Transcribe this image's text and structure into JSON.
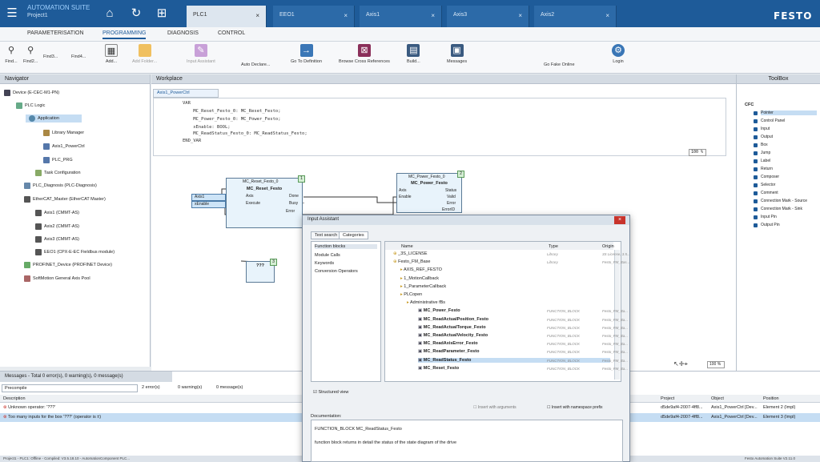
{
  "app": {
    "title": "AUTOMATION SUITE",
    "project": "Project1",
    "logo": "FESTO"
  },
  "tabs": [
    {
      "label": "PLC1",
      "active": true
    },
    {
      "label": "EEO1"
    },
    {
      "label": "Axis1"
    },
    {
      "label": "Axis3"
    },
    {
      "label": "Axis2"
    }
  ],
  "menu": [
    "PARAMETERISATION",
    "PROGRAMMING",
    "DIAGNOSIS",
    "CONTROL"
  ],
  "ribbon": [
    "Find...",
    "Find2...",
    "Find3...",
    "Find4...",
    "Add...",
    "Add Folder...",
    "Input Assistant",
    "Auto Declare...",
    "Go To Definition",
    "Browse Cross References",
    "Build...",
    "Messages",
    "Go Fake Online",
    "Login"
  ],
  "navigator": {
    "title": "Navigator",
    "items": [
      "Device (E-CEC-M1-PN)",
      "PLC Logic",
      "Application",
      "Library Manager",
      "Axis1_PowerCtrl",
      "PLC_PRG",
      "Task Configuration",
      "PLC_Diagnosis (PLC-Diagnosis)",
      "EtherCAT_Master (EtherCAT Master)",
      "Axis1 (CMMT-AS)",
      "Axis2 (CMMT-AS)",
      "Axis3 (CMMT-AS)",
      "EEO1 (CPX-E-EC Fieldbus module)",
      "PROFINET_Device (PROFINET Device)",
      "SoftMotion General Axis Pool"
    ]
  },
  "workplace": {
    "title": "Workplace",
    "editor_tab": "Axis1_PowerCtrl",
    "decl": [
      "VAR",
      "    MC_Reset_Festo_0: MC_Reset_Festo;",
      "    MC_Power_Festo_0: MC_Power_Festo;",
      "    xEnable: BOOL;",
      "    MC_ReadStatus_Festo_0: MC_ReadStatus_Festo;",
      "END_VAR"
    ],
    "zoom_decl": "100 %",
    "zoom_cfc": "100 %",
    "blocks": {
      "reset": {
        "instance": "MC_Reset_Festo_0",
        "type": "MC_Reset_Festo",
        "inputs": [
          "Axis",
          "Execute"
        ],
        "outputs": [
          "Done",
          "Busy",
          "Error"
        ],
        "tag": "1"
      },
      "power": {
        "instance": "MC_Power_Festo_0",
        "type": "MC_Power_Festo",
        "inputs": [
          "Axis",
          "Enable"
        ],
        "outputs": [
          "Status",
          "Valid",
          "Error",
          "ErrorID"
        ],
        "tag": "2"
      },
      "unknown": {
        "label": "???",
        "tag": "3"
      }
    },
    "vars": [
      "Axis1",
      "xEnable"
    ]
  },
  "toolbox": {
    "title": "ToolBox",
    "group": "CFC",
    "items": [
      "Pointer",
      "Control Panel",
      "Input",
      "Output",
      "Box",
      "Jump",
      "Label",
      "Return",
      "Composer",
      "Selector",
      "Comment",
      "Connection Mark - Source",
      "Connection Mark - Sink",
      "Input Pin",
      "Output Pin"
    ]
  },
  "messages": {
    "title": "Messages - Total 0 error(s), 0 warning(s), 0 message(s)",
    "filter": "Precompile",
    "counters": [
      "2 error(s)",
      "0 warning(s)",
      "0 message(s)"
    ],
    "columns": [
      "Description",
      "Project",
      "Object",
      "Position"
    ],
    "rows": [
      {
        "desc": "Unknown operator: '???'",
        "project": "d5de9af4-2007-4ff8...",
        "object": "Axis1_PowerCtrl [Dev...",
        "pos": "Element 2 (Impl)"
      },
      {
        "desc": "Too many inputs for the box '???' (operator is ±)",
        "project": "d5de9af4-2007-4ff8...",
        "object": "Axis1_PowerCtrl [Dev...",
        "pos": "Element 3 (Impl)"
      }
    ],
    "status_left": "Project1 - PLC1: Offline - Compiled: V3.5.18.10 - AutomationComponent PLC...",
    "status_right": "Festo Automation Suite V2.11.0"
  },
  "dialog": {
    "title": "Input Assistant",
    "tabs": [
      "Text search",
      "Categories"
    ],
    "categories": [
      "Function blocks",
      "Module Calls",
      "Keywords",
      "Conversion Operators"
    ],
    "columns": [
      "Name",
      "Type",
      "Origin"
    ],
    "rows": [
      {
        "name": "_3S_LICENSE",
        "type": "Library",
        "origin": "3S License, 3.5...",
        "level": 1,
        "bold": false
      },
      {
        "name": "Festo_FM_Base",
        "type": "Library",
        "origin": "Festo_FM_Bas...",
        "level": 1,
        "bold": false
      },
      {
        "name": "AXIS_REF_FESTO",
        "type": "",
        "origin": "",
        "level": 2,
        "bold": false
      },
      {
        "name": "1_MotionCallback",
        "type": "",
        "origin": "",
        "level": 2,
        "bold": false
      },
      {
        "name": "1_ParameterCallback",
        "type": "",
        "origin": "",
        "level": 2,
        "bold": false
      },
      {
        "name": "PLCopen",
        "type": "",
        "origin": "",
        "level": 2,
        "bold": false
      },
      {
        "name": "Administrative fBs",
        "type": "",
        "origin": "",
        "level": 3,
        "bold": false
      },
      {
        "name": "MC_Power_Festo",
        "type": "FUNCTION_BLOCK",
        "origin": "Festo_FM_Ba...",
        "level": 4,
        "bold": true
      },
      {
        "name": "MC_ReadActualPosition_Festo",
        "type": "FUNCTION_BLOCK",
        "origin": "Festo_FM_Ba...",
        "level": 4,
        "bold": true
      },
      {
        "name": "MC_ReadActualTorque_Festo",
        "type": "FUNCTION_BLOCK",
        "origin": "Festo_FM_Ba...",
        "level": 4,
        "bold": true
      },
      {
        "name": "MC_ReadActualVelocity_Festo",
        "type": "FUNCTION_BLOCK",
        "origin": "Festo_FM_Ba...",
        "level": 4,
        "bold": true
      },
      {
        "name": "MC_ReadAxisError_Festo",
        "type": "FUNCTION_BLOCK",
        "origin": "Festo_FM_Ba...",
        "level": 4,
        "bold": true
      },
      {
        "name": "MC_ReadParameter_Festo",
        "type": "FUNCTION_BLOCK",
        "origin": "Festo_FM_Ba...",
        "level": 4,
        "bold": true
      },
      {
        "name": "MC_ReadStatus_Festo",
        "type": "FUNCTION_BLOCK",
        "origin": "Festo_FM_Ba...",
        "level": 4,
        "bold": true,
        "selected": true
      },
      {
        "name": "MC_Reset_Festo",
        "type": "FUNCTION_BLOCK",
        "origin": "Festo_FM_Ba...",
        "level": 4,
        "bold": true
      }
    ],
    "structured_view": "Structured view",
    "insert_args": "Insert with arguments",
    "insert_ns": "Insert with namespace prefix",
    "documentation_label": "Documentation:",
    "doc_line1": "FUNCTION_BLOCK MC_ReadStatus_Festo",
    "doc_line2": "function block returns in detail the status of the state diagram of the drive"
  }
}
